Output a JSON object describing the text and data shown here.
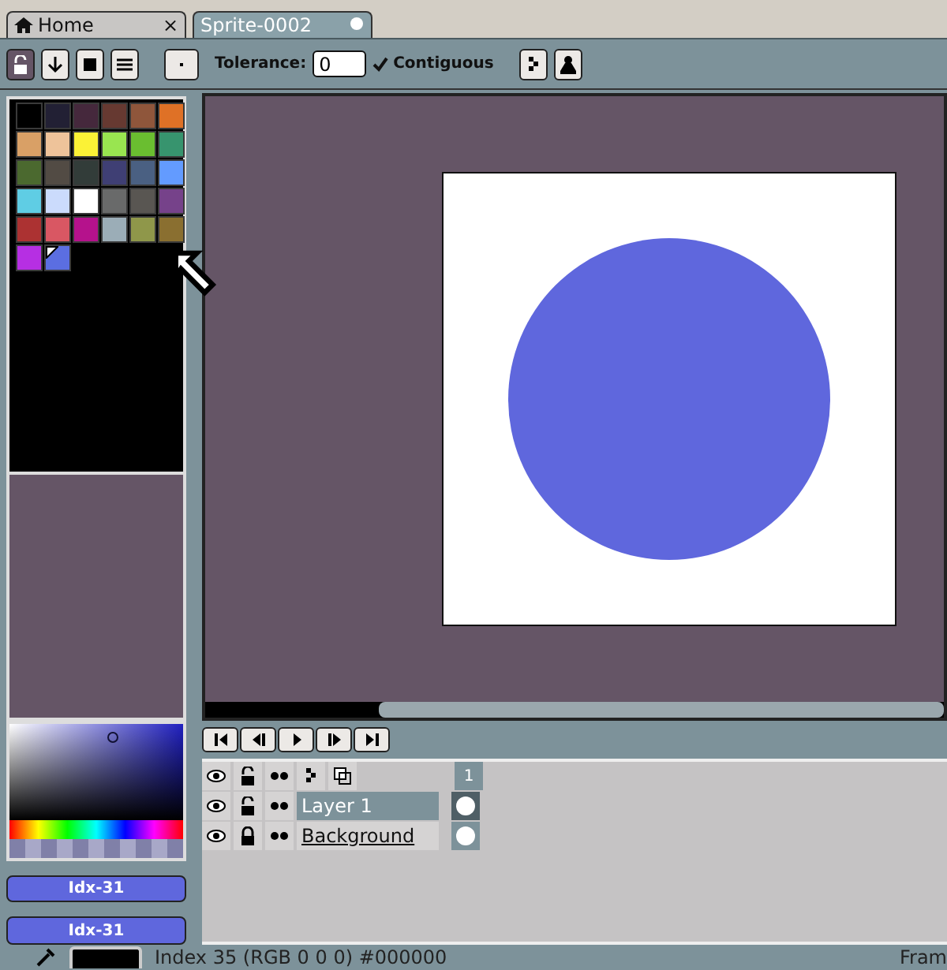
{
  "tabs": [
    {
      "label": "Home",
      "kind": "home",
      "selected": false,
      "close": "×"
    },
    {
      "label": "Sprite-0002",
      "kind": "doc",
      "selected": true
    }
  ],
  "toolbar": {
    "tolerance_label": "Tolerance:",
    "tolerance": "0",
    "contiguous": {
      "label": "Contiguous",
      "checked": true
    }
  },
  "palette": [
    {
      "color": "#000000",
      "selected": false
    },
    {
      "color": "#222034",
      "selected": false
    },
    {
      "color": "#45283c",
      "selected": false
    },
    {
      "color": "#663931",
      "selected": false
    },
    {
      "color": "#8f563b",
      "selected": false
    },
    {
      "color": "#df7126",
      "selected": false
    },
    {
      "color": "#d9a066",
      "selected": false
    },
    {
      "color": "#eec39a",
      "selected": false
    },
    {
      "color": "#fbf236",
      "selected": false
    },
    {
      "color": "#99e550",
      "selected": false
    },
    {
      "color": "#6abe30",
      "selected": false
    },
    {
      "color": "#37946e",
      "selected": false
    },
    {
      "color": "#4b692f",
      "selected": false
    },
    {
      "color": "#524b44",
      "selected": false
    },
    {
      "color": "#323c39",
      "selected": false
    },
    {
      "color": "#3f3f74",
      "selected": false
    },
    {
      "color": "#4a6082",
      "selected": false
    },
    {
      "color": "#639bff",
      "selected": false
    },
    {
      "color": "#5fcde4",
      "selected": false
    },
    {
      "color": "#cbdbfc",
      "selected": false
    },
    {
      "color": "#ffffff",
      "selected": false
    },
    {
      "color": "#696a6a",
      "selected": false
    },
    {
      "color": "#595652",
      "selected": false
    },
    {
      "color": "#76428a",
      "selected": false
    },
    {
      "color": "#ac3232",
      "selected": false
    },
    {
      "color": "#d95763",
      "selected": false
    },
    {
      "color": "#b5128c",
      "selected": false
    },
    {
      "color": "#9badb7",
      "selected": false
    },
    {
      "color": "#8f974a",
      "selected": false
    },
    {
      "color": "#8a6f30",
      "selected": false
    },
    {
      "color": "#b62fe3",
      "selected": false
    },
    {
      "color": "#5b6ee1",
      "selected": true
    }
  ],
  "color_buttons": [
    "Idx-31",
    "Idx-31"
  ],
  "timeline": {
    "frame": "1",
    "layers": [
      {
        "name": "Layer 1",
        "selected": true,
        "locked": false
      },
      {
        "name": "Background",
        "selected": false,
        "locked": true
      }
    ]
  },
  "status_bar": {
    "text": "Index 35 (RGB 0 0 0) #000000",
    "right": "Fram"
  }
}
